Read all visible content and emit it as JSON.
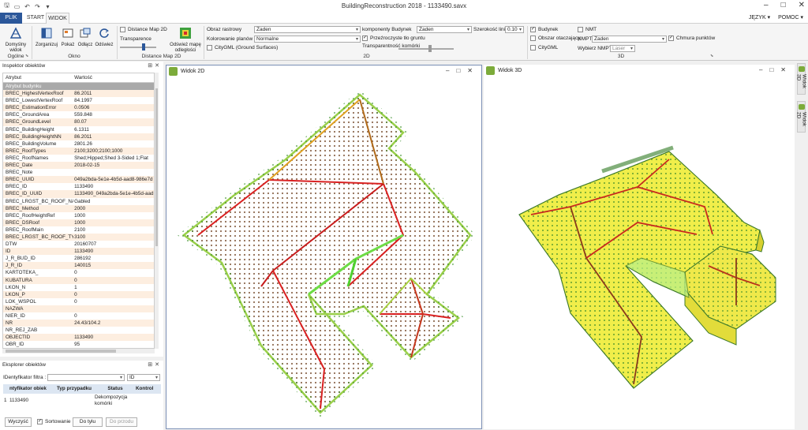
{
  "app": {
    "title": "BuildingReconstruction 2018 - 1133490.savx",
    "qat_icons": [
      "save-icon",
      "folder-icon",
      "undo-icon",
      "redo-icon",
      "dropdown-icon"
    ]
  },
  "tabs": [
    "PLIK",
    "START",
    "WIDOK"
  ],
  "menus": {
    "language": "JĘZYK ▾",
    "help": "POMOC ▾"
  },
  "ribbon": {
    "general": {
      "button": "Domyślny widok",
      "group": "Ogólne"
    },
    "window": {
      "buttons": [
        "Zorganizuj",
        "Pokaż",
        "Odłącz",
        "Odśwież"
      ],
      "group": "Okno"
    },
    "distance_map": {
      "check": "Distance Map 2D",
      "transparency": "Transparence",
      "refresh": "Odśwież mapę odległości",
      "group": "Distance Map 2D"
    },
    "view2d": {
      "raster_label": "Obraz rastrowy",
      "raster_value": "Żaden",
      "plan_color_label": "Kolorowanie planów",
      "plan_color_value": "Normalne",
      "citygml_check": "CityGML (Ground Surfaces)",
      "components_label": "komponenty Budynek",
      "components_value": "Żaden",
      "line_width_label": "Szerokość linii",
      "line_width_value": "0.10",
      "transparent_bg": "Przeźroczyste tło gruntu",
      "cell_transparency": "Transparentność komórki",
      "group": "2D"
    },
    "view3d": {
      "building": "Budynek",
      "nmt": "NMT",
      "surrounding": "Obszar otaczający",
      "nmpt_label": "NMPT",
      "nmpt_value": "Żaden",
      "pointcloud": "Chmura punktów",
      "citygml": "CityGML",
      "select_nmpt_label": "Wybierz NMPT",
      "select_nmpt_value": "Laser",
      "group": "3D"
    }
  },
  "inspector": {
    "title": "Inspektor obiektów",
    "col_attr": "Atrybut",
    "col_value": "Wartość",
    "section": "Atrybut budynku",
    "rows": [
      [
        "BREC_HighestVertexRoof",
        "86.2011"
      ],
      [
        "BREC_LowestVertexRoof",
        "84.1997"
      ],
      [
        "BREC_EstimationError",
        "0.0506"
      ],
      [
        "BREC_GroundArea",
        "559.848"
      ],
      [
        "BREC_GroundLevel",
        "80.07"
      ],
      [
        "BREC_BuildingHeight",
        "6.1311"
      ],
      [
        "BREC_BuildingHeightNN",
        "86.2011"
      ],
      [
        "BREC_BuildingVolume",
        "2801.26"
      ],
      [
        "BREC_RoofTypes",
        "2100;3200;2100;1000"
      ],
      [
        "BREC_RoofNames",
        "Shed;Hipped;Shed 3-Sided 1;Flat"
      ],
      [
        "BREC_Date",
        "2018-02-15"
      ],
      [
        "BREC_Note",
        ""
      ],
      [
        "BREC_UUID",
        "049a2bda-5e1e-4b5d-aad8-986e7d"
      ],
      [
        "BREC_ID",
        "1133490"
      ],
      [
        "BREC_ID_UUID",
        "1133490_049a2bda-5e1e-4b5d-aad"
      ],
      [
        "BREC_LRGST_BC_ROOF_NAME",
        "Gabled"
      ],
      [
        "BREC_Method",
        "2000"
      ],
      [
        "BREC_RoofHeightRef",
        "1000"
      ],
      [
        "BREC_DSRoof",
        "1000"
      ],
      [
        "BREC_RoofMain",
        "2100"
      ],
      [
        "BREC_LRGST_BC_ROOF_TYPE",
        "3100"
      ],
      [
        "DTW",
        "20160707"
      ],
      [
        "ID",
        "1133490"
      ],
      [
        "J_R_BUD_ID",
        "286192"
      ],
      [
        "J_R_ID",
        "140015"
      ],
      [
        "KARTOTEKA_",
        "0"
      ],
      [
        "KUBATURA",
        "0"
      ],
      [
        "LKON_N",
        "1"
      ],
      [
        "LKON_P",
        "0"
      ],
      [
        "LOK_WSPOL",
        "0"
      ],
      [
        "NAZWA",
        ""
      ],
      [
        "NIER_ID",
        "0"
      ],
      [
        "NR",
        "24.43/104.2"
      ],
      [
        "NR_REJ_ZAB",
        ""
      ],
      [
        "OBJECTID",
        "1133490"
      ],
      [
        "OBR_ID",
        "95"
      ]
    ]
  },
  "explorer": {
    "title": "Eksplorer obiektów",
    "filter_label": "IDentyfikator filtra :",
    "filter_value": "",
    "filter_field": "ID",
    "columns": [
      "ntyfikator obiek",
      "Typ przypadku",
      "Status",
      "Kontrol"
    ],
    "rows": [
      [
        "1",
        "1133490",
        "",
        "Dekompozycja komórki"
      ]
    ],
    "buttons": {
      "clear": "Wyczyść",
      "sort": "Sortowanie",
      "back": "Do tyłu",
      "forward": "Do przodu"
    }
  },
  "views": {
    "view2d_title": "Widok 2D",
    "view3d_title": "Widok 3D",
    "side_tabs": [
      "Widok 3D",
      "Widok 2D"
    ]
  },
  "colors": {
    "accent": "#2b579a",
    "roof_yellow": "#f0f04a",
    "ridge_red": "#d82020",
    "point_green": "#2f8f2f"
  }
}
